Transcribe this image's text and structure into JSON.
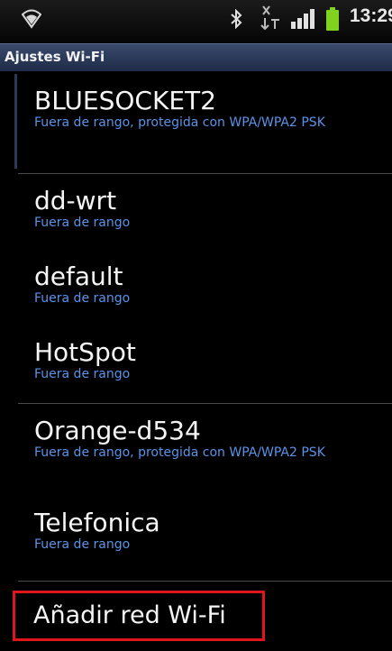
{
  "status_bar": {
    "time": "13:29",
    "icons": [
      "wifi-icon",
      "bluetooth-icon",
      "data-transfer-icon",
      "signal-strength-icon",
      "battery-icon"
    ]
  },
  "title_bar": {
    "title": "Ajustes Wi-Fi"
  },
  "networks": [
    {
      "ssid": "BLUESOCKET2",
      "status": "Fuera de rango, protegida con WPA/WPA2 PSK"
    },
    {
      "ssid": "dd-wrt",
      "status": "Fuera de rango"
    },
    {
      "ssid": "default",
      "status": "Fuera de rango"
    },
    {
      "ssid": "HotSpot",
      "status": "Fuera de rango"
    },
    {
      "ssid": "Orange-d534",
      "status": "Fuera de rango, protegida con WPA/WPA2 PSK"
    },
    {
      "ssid": "Telefonica",
      "status": "Fuera de rango"
    }
  ],
  "add_network": {
    "label": "Añadir red Wi-Fi"
  },
  "colors": {
    "accent": "#5a93e8",
    "highlight_border": "#e0141c",
    "title_bar": "#2c3a5c",
    "battery": "#7fd21e"
  }
}
